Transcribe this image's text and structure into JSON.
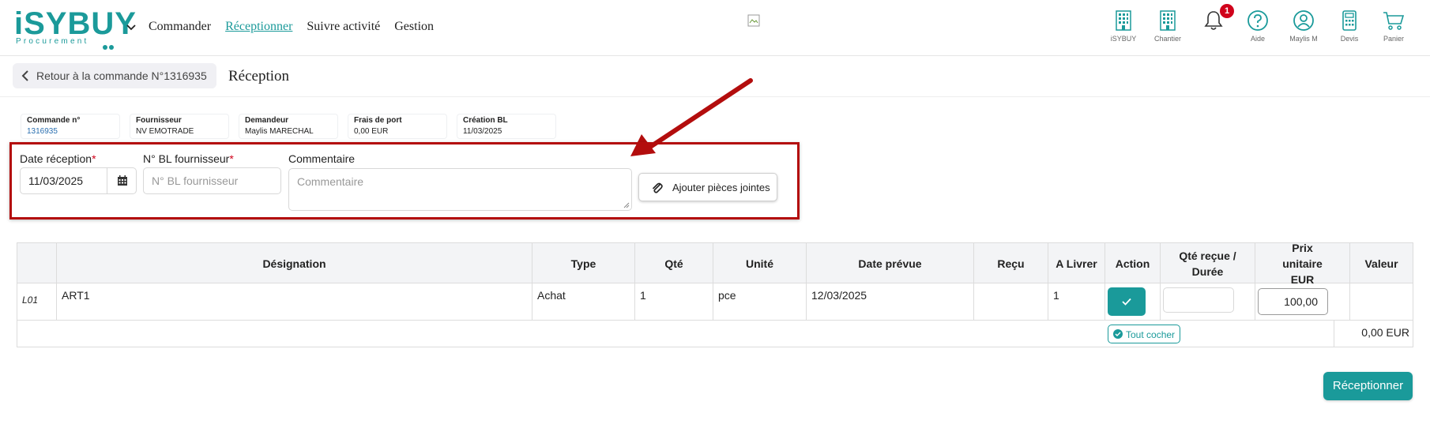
{
  "brand": {
    "logo_text": "iSYBUY",
    "logo_subtext": "Procurement"
  },
  "nav": {
    "items": [
      "Commander",
      "Réceptionner",
      "Suivre activité",
      "Gestion"
    ],
    "active": "Réceptionner"
  },
  "top_icons": [
    {
      "icon": "building-icon",
      "label": "iSYBUY"
    },
    {
      "icon": "building-icon",
      "label": "Chantier"
    },
    {
      "icon": "bell-icon",
      "label": "",
      "badge": "1"
    },
    {
      "icon": "help-icon",
      "label": "Aide"
    },
    {
      "icon": "user-icon",
      "label": "Maylis M"
    },
    {
      "icon": "calculator-icon",
      "label": "Devis"
    },
    {
      "icon": "cart-icon",
      "label": "Panier"
    }
  ],
  "back_button": {
    "label": "Retour à la commande N°1316935"
  },
  "page_title": "Réception",
  "info_cards": [
    {
      "title": "Commande n°",
      "value": "1316935",
      "link": true
    },
    {
      "title": "Fournisseur",
      "value": "NV EMOTRADE",
      "link": false
    },
    {
      "title": "Demandeur",
      "value": "Maylis MARECHAL",
      "link": false
    },
    {
      "title": "Frais de port",
      "value": "0,00 EUR",
      "link": false
    },
    {
      "title": "Création BL",
      "value": "11/03/2025",
      "link": false
    }
  ],
  "form": {
    "date_label": "Date réception",
    "date_value": "11/03/2025",
    "bl_label": "N° BL fournisseur",
    "bl_placeholder": "N° BL fournisseur",
    "comment_label": "Commentaire",
    "comment_placeholder": "Commentaire",
    "required_mark": "*",
    "attach_label": "Ajouter pièces jointes"
  },
  "table": {
    "columns": [
      "",
      "Désignation",
      "Type",
      "Qté",
      "Unité",
      "Date prévue",
      "Reçu",
      "A Livrer",
      "Action",
      "Qté reçue / Durée",
      "Prix unitaire EUR",
      "Valeur"
    ],
    "rows": [
      {
        "line": "L01",
        "designation": "ART1",
        "type": "Achat",
        "qty": "1",
        "unit": "pce",
        "date": "12/03/2025",
        "received": "",
        "to_deliver": "1",
        "qty_received": "",
        "unit_price": "100,00",
        "value": ""
      }
    ],
    "select_all_label": "Tout cocher",
    "total": "0,00 EUR"
  },
  "submit_label": "Réceptionner",
  "colors": {
    "accent": "#1a9a9a",
    "highlight_border": "#b30d0d",
    "badge": "#d0021b"
  }
}
